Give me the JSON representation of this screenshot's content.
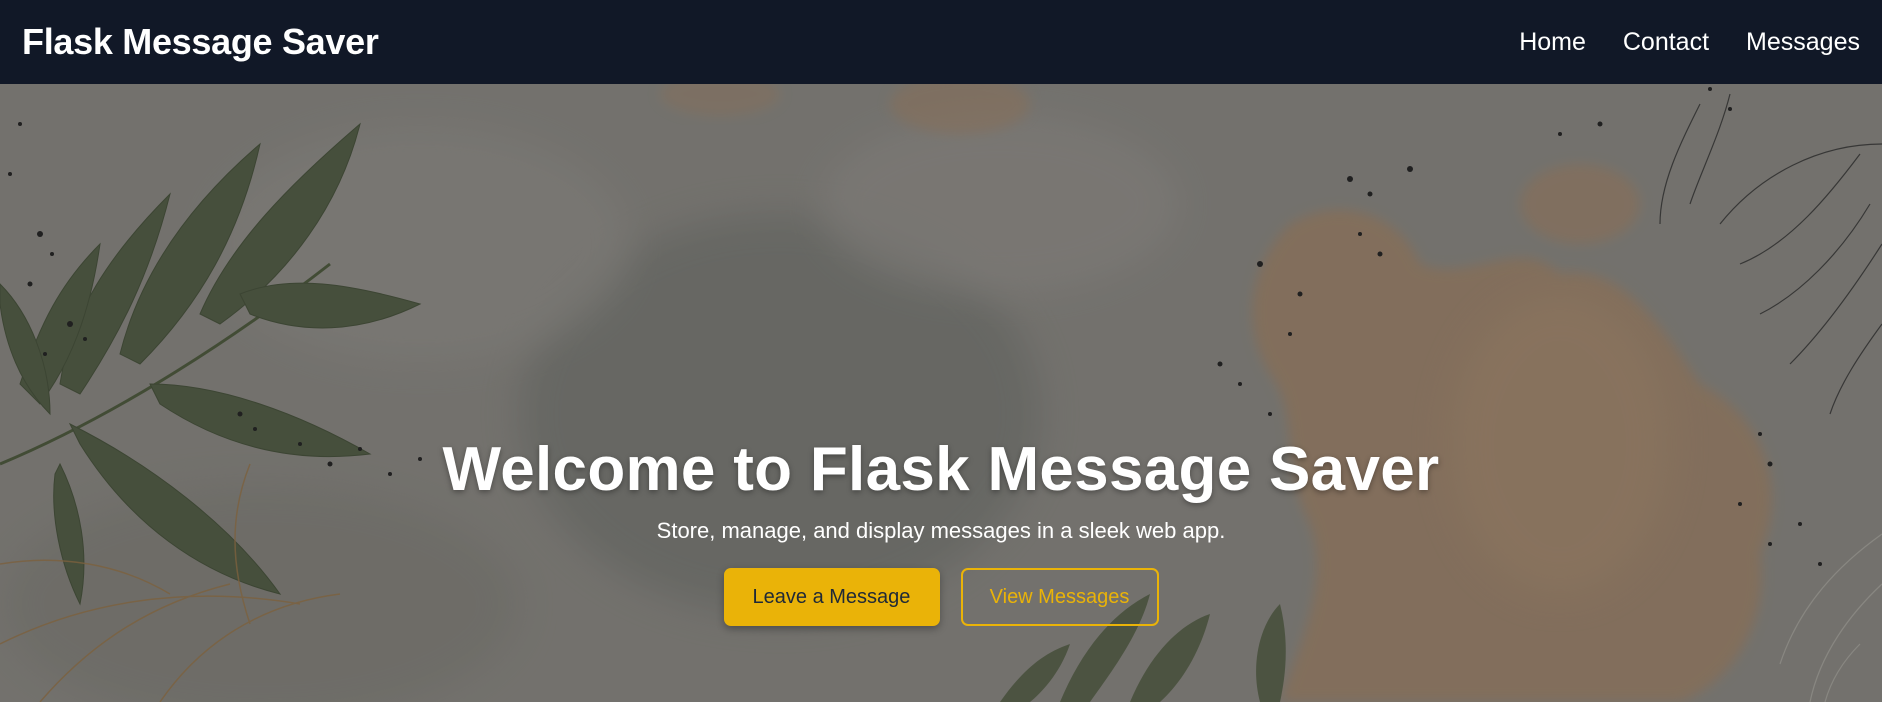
{
  "nav": {
    "brand": "Flask Message Saver",
    "links": [
      {
        "label": "Home"
      },
      {
        "label": "Contact"
      },
      {
        "label": "Messages"
      }
    ]
  },
  "hero": {
    "title": "Welcome to Flask Message Saver",
    "subtitle": "Store, manage, and display messages in a sleek web app.",
    "primary_button": "Leave a Message",
    "secondary_button": "View Messages"
  },
  "colors": {
    "navbar_bg": "#111827",
    "accent": "#eab308",
    "leaf_green": "#5c6b4a",
    "watercolor_beige": "#c9a27e"
  },
  "icons": {
    "background": "watercolor-leaves-illustration"
  }
}
